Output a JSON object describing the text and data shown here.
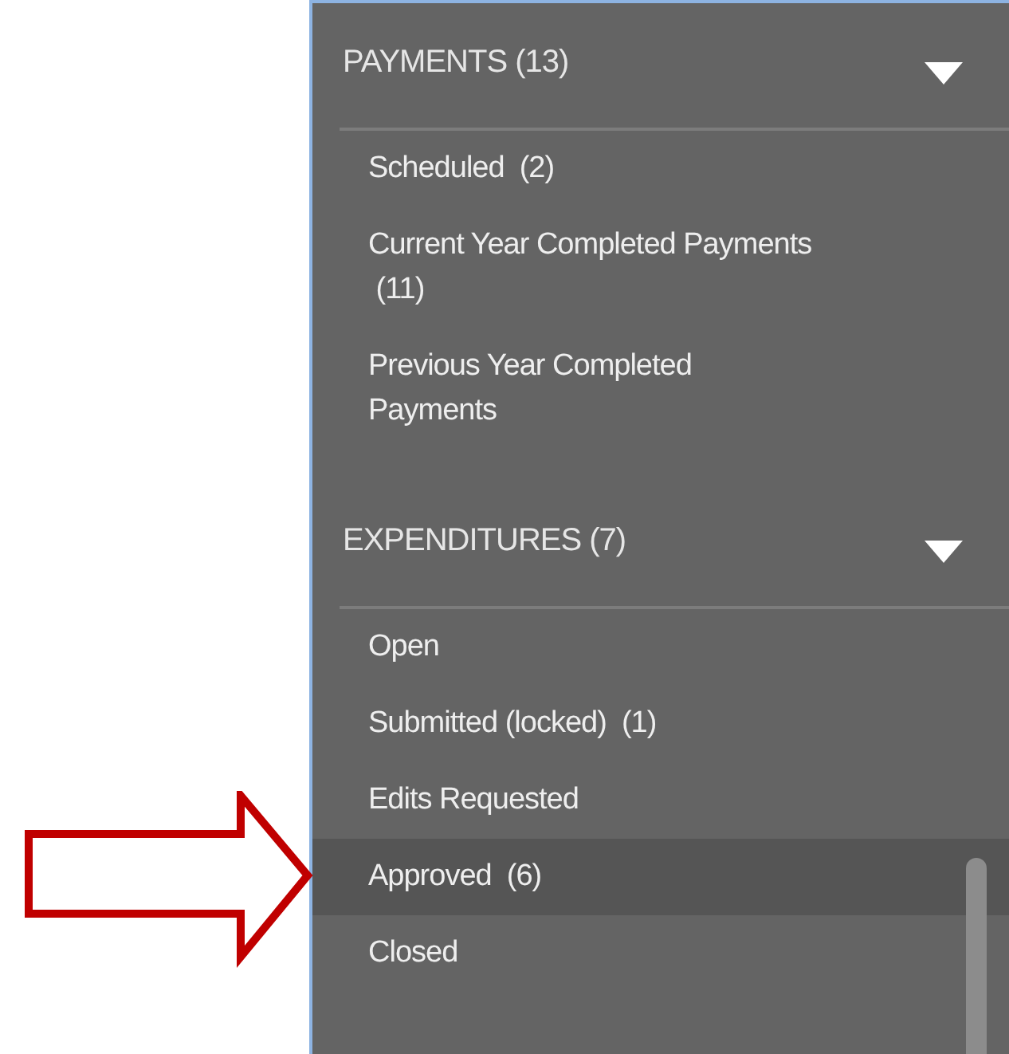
{
  "sections": [
    {
      "title": "PAYMENTS (13)",
      "expanded": true,
      "items": [
        {
          "label": "Scheduled  (2)",
          "selected": false
        },
        {
          "label": "Current Year Completed Payments\n (11)",
          "selected": false
        },
        {
          "label": "Previous Year Completed\nPayments",
          "selected": false
        }
      ]
    },
    {
      "title": "EXPENDITURES (7)",
      "expanded": true,
      "items": [
        {
          "label": "Open",
          "selected": false
        },
        {
          "label": "Submitted (locked)  (1)",
          "selected": false
        },
        {
          "label": "Edits Requested",
          "selected": false
        },
        {
          "label": "Approved  (6)",
          "selected": true
        },
        {
          "label": "Closed",
          "selected": false
        }
      ]
    }
  ]
}
